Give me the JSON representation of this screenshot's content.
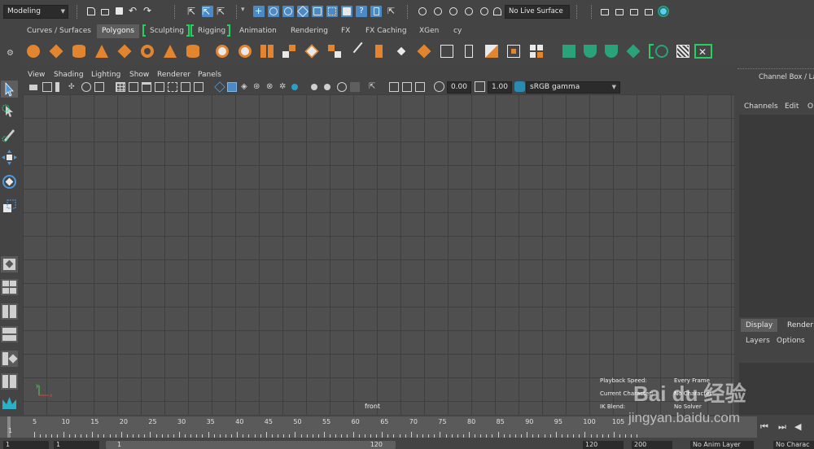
{
  "status_line": {
    "mode": "Modeling",
    "live_surface": "No Live Surface"
  },
  "shelf": {
    "tabs": [
      {
        "label": "Curves / Surfaces"
      },
      {
        "label": "Polygons"
      },
      {
        "label": "Sculpting"
      },
      {
        "label": "Rigging"
      },
      {
        "label": "Animation"
      },
      {
        "label": "Rendering"
      },
      {
        "label": "FX"
      },
      {
        "label": "FX Caching"
      },
      {
        "label": "XGen"
      },
      {
        "label": "cy"
      }
    ],
    "active_tab": "Polygons"
  },
  "viewport": {
    "menu": [
      "View",
      "Shading",
      "Lighting",
      "Show",
      "Renderer",
      "Panels"
    ],
    "exposure": "0.00",
    "gamma": "1.00",
    "color_space": "sRGB gamma",
    "camera": "front",
    "hud": {
      "playback_speed_label": "Playback Speed:",
      "playback_speed_value": "Every Frame",
      "current_character_label": "Current Character:",
      "current_character_value": "No Character",
      "ik_blend_label": "IK Blend:",
      "ik_blend_value": "No Solver"
    }
  },
  "channel_box": {
    "title": "Channel Box / Layer",
    "menu": [
      "Channels",
      "Edit",
      "O"
    ]
  },
  "layer_editor": {
    "tabs": [
      "Display",
      "Render"
    ],
    "menu": [
      "Layers",
      "Options"
    ]
  },
  "time_slider": {
    "ticks": [
      "5",
      "10",
      "15",
      "20",
      "25",
      "30",
      "35",
      "40",
      "45",
      "50",
      "55",
      "60",
      "65",
      "70",
      "75",
      "80",
      "85",
      "90",
      "95",
      "100",
      "105"
    ],
    "current_frame": "1"
  },
  "range_slider": {
    "start": "1",
    "playback_start": "1",
    "range_start_inner": "1",
    "range_end_inner": "120",
    "playback_end": "120",
    "end": "200",
    "anim_layer": "No Anim Layer",
    "character": "No Charac"
  },
  "watermark": {
    "logo": "Bai du 经验",
    "url": "jingyan.baidu.com"
  },
  "colors": {
    "accent_blue": "#4b8ac5",
    "shelf_orange": "#e3852e",
    "bracket_green": "#24d060",
    "axis_red": "#e0403a",
    "axis_green": "#50d050",
    "axis_blue": "#4a78e8"
  }
}
